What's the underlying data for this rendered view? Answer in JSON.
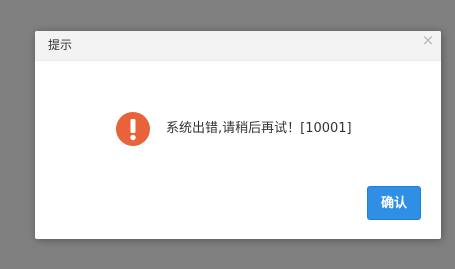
{
  "dialog": {
    "title": "提示",
    "close_glyph": "×",
    "message": "系统出错,请稍后再试！[10001]",
    "icon": "warning-icon",
    "confirm_label": "确认"
  },
  "colors": {
    "overlay": "#808080",
    "header_bg": "#f3f3f3",
    "warning_orange": "#e8623a",
    "confirm_blue": "#2e8fe5"
  }
}
